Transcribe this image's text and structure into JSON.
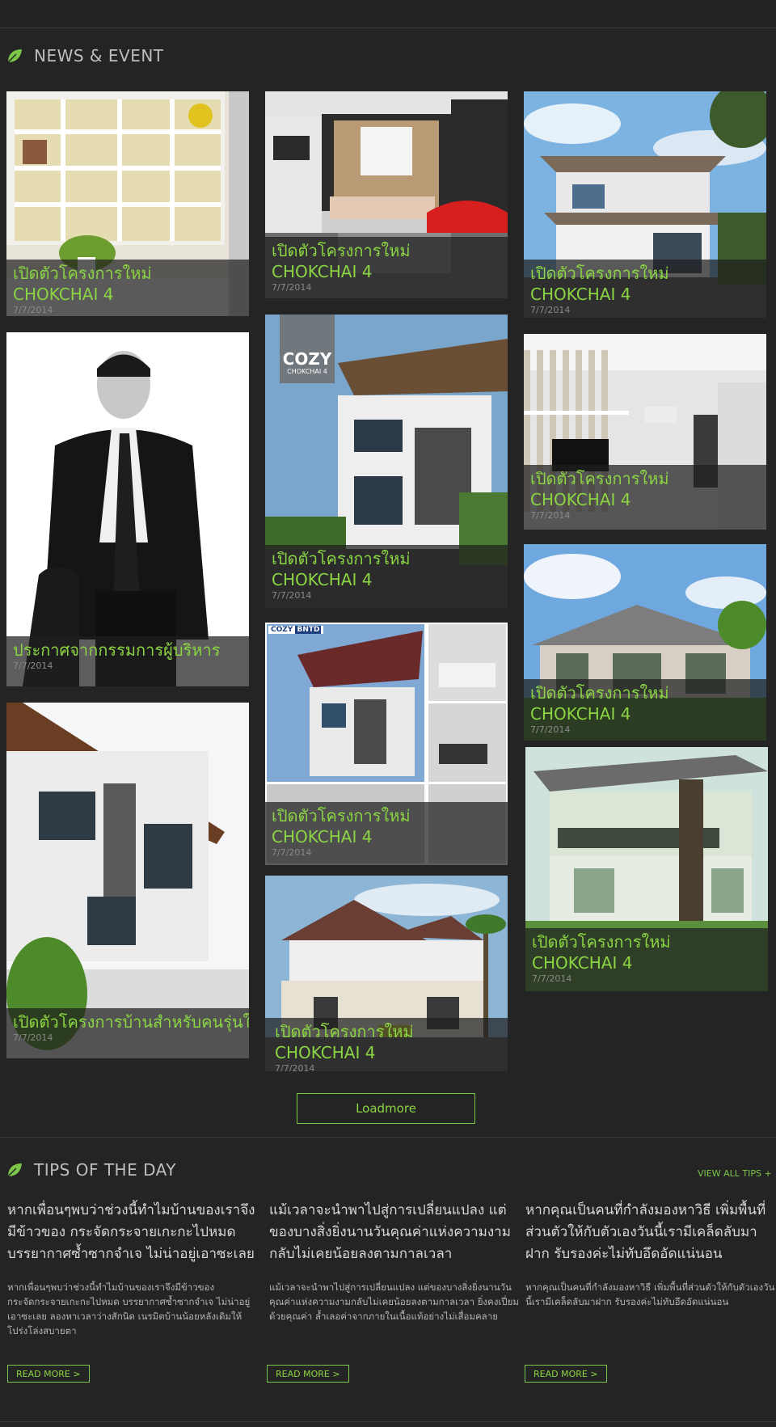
{
  "news": {
    "title": "NEWS & EVENT",
    "cards": [
      {
        "line1": "เปิดตัวโครงการใหม่",
        "line2": "CHOKCHAI 4",
        "date": "7/7/2014"
      },
      {
        "line1": "เปิดตัวโครงการใหม่",
        "line2": "CHOKCHAI 4",
        "date": "7/7/2014"
      },
      {
        "line1": "เปิดตัวโครงการใหม่",
        "line2": "CHOKCHAI 4",
        "date": "7/7/2014"
      },
      {
        "line1": "ประกาศจากกรรมการผู้บริหาร",
        "line2": "",
        "date": "7/7/2014"
      },
      {
        "line1": "เปิดตัวโครงการใหม่",
        "line2": "CHOKCHAI 4",
        "date": "7/7/2014",
        "badge": "COZY",
        "badge_sub": "CHOKCHAI 4"
      },
      {
        "line1": "เปิดตัวโครงการใหม่",
        "line2": "CHOKCHAI 4",
        "date": "7/7/2014"
      },
      {
        "line1": "เปิดตัวโครงการใหม่",
        "line2": "CHOKCHAI 4",
        "date": "7/7/2014",
        "badge": "COZY",
        "badge_sub": "BNTD"
      },
      {
        "line1": "เปิดตัวโครงการใหม่",
        "line2": "CHOKCHAI 4",
        "date": "7/7/2014"
      },
      {
        "line1": "เปิดตัวโครงการบ้านสำหรับคนรุ่นใหม่",
        "line2": "",
        "date": "7/7/2014"
      },
      {
        "line1": "เปิดตัวโครงการใหม่",
        "line2": "CHOKCHAI 4",
        "date": "7/7/2014"
      },
      {
        "line1": "เปิดตัวโครงการใหม่",
        "line2": "CHOKCHAI 4",
        "date": "7/7/2014"
      }
    ],
    "loadmore_label": "Loadmore"
  },
  "tips": {
    "title": "TIPS OF THE DAY",
    "view_all": "VIEW ALL TIPS  +",
    "readmore_label": "READ MORE  >",
    "items": [
      {
        "title": "หากเพื่อนๆพบว่าช่วงนี้ทำไมบ้านของเราจึงมีข้าวของ กระจัดกระจายเกะกะไปหมด บรรยากาศซ้ำซากจำเจ ไม่น่าอยู่เอาซะเลย",
        "body": "หากเพื่อนๆพบว่าช่วงนี้ทำไมบ้านของเราจึงมีข้าวของ กระจัดกระจายเกะกะไปหมด บรรยากาศซ้ำซากจำเจ ไม่น่าอยู่เอาซะเลย ลองหาเวลาว่างสักนิด เนรมิตบ้านน้อยหลังเดิมให้โปร่งโล่งสบายตา"
      },
      {
        "title": "แม้เวลาจะนำพาไปสู่การเปลี่ยนแปลง แต่ของบางสิ่งยิ่งนานวันคุณค่าแห่งความงามกลับไม่เคยน้อยลงตามกาลเวลา",
        "body": "แม้เวลาจะนำพาไปสู่การเปลี่ยนแปลง แต่ของบางสิ่งยิ่งนานวันคุณค่าแห่งความงามกลับไม่เคยน้อยลงตามกาลเวลา ยิ่งคงเปี่ยมด้วยคุณค่า ล้ำเลอค่าจากภายในเนื้อแท้อย่างไม่เสื่อมคลาย"
      },
      {
        "title": "หากคุณเป็นคนที่กำลังมองหาวิธี เพิ่มพื้นที่ส่วนตัวให้กับตัวเองวันนี้เรามีเคล็ดลับมาฝาก รับรองค่ะไม่ทับอึดอัดแน่นอน",
        "body": "หากคุณเป็นคนที่กำลังมองหาวิธี เพิ่มพื้นที่ส่วนตัวให้กับตัวเองวันนี้เรามีเคล็ดลับมาฝาก รับรองค่ะไม่ทับอึดอัดแน่นอน"
      }
    ]
  },
  "colors": {
    "accent": "#8bd443",
    "background": "#242424"
  }
}
